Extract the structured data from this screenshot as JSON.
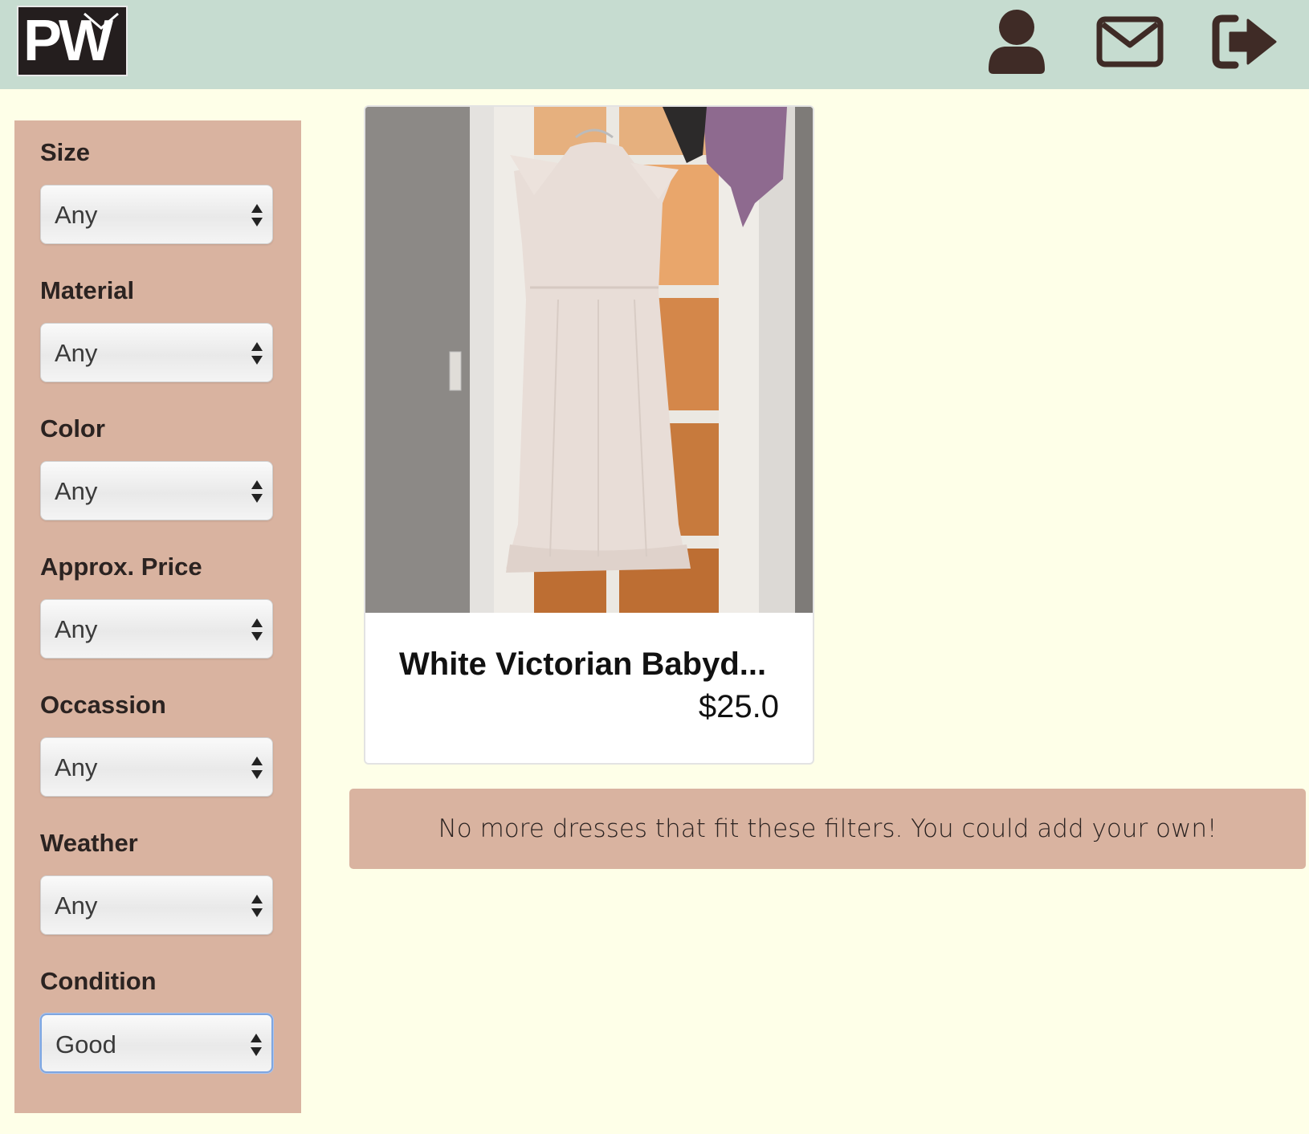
{
  "header": {
    "logo_text": "PW",
    "icons": [
      "user-icon",
      "envelope-icon",
      "sign-out-icon"
    ],
    "background": "#C6DCD0",
    "icon_color": "#3F2B26"
  },
  "sidebar": {
    "background": "#D9B3A0",
    "filters": [
      {
        "label": "Size",
        "value": "Any"
      },
      {
        "label": "Material",
        "value": "Any"
      },
      {
        "label": "Color",
        "value": "Any"
      },
      {
        "label": "Approx. Price",
        "value": "Any"
      },
      {
        "label": "Occassion",
        "value": "Any"
      },
      {
        "label": "Weather",
        "value": "Any"
      },
      {
        "label": "Condition",
        "value": "Good"
      }
    ]
  },
  "listing": {
    "title": "White Victorian Babyd...",
    "price": "$25.0"
  },
  "notice": {
    "text": "No more dresses that fit these filters. You could add your own!"
  }
}
